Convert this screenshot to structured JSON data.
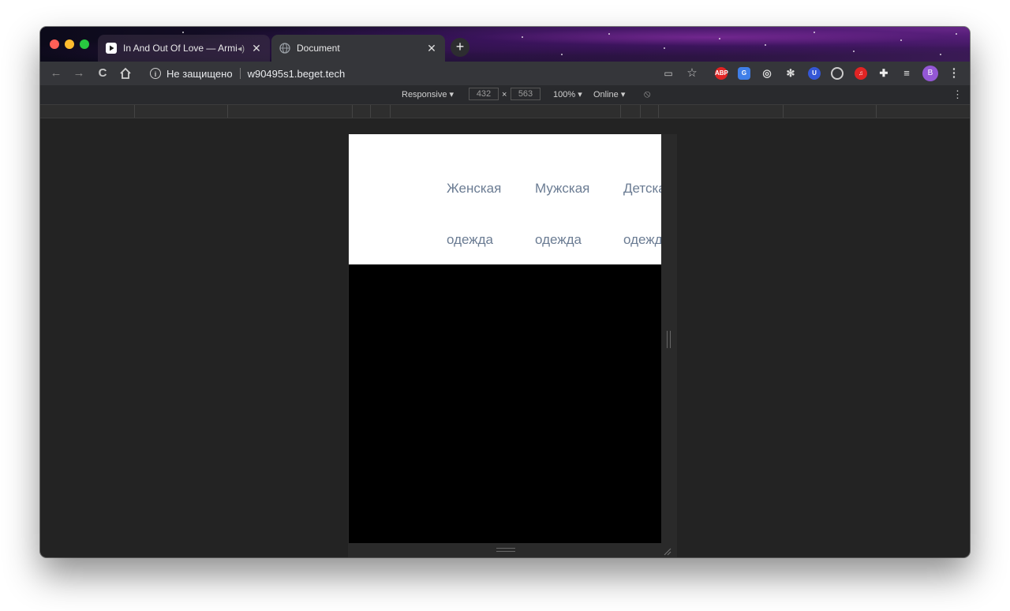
{
  "browser": {
    "tabs": [
      {
        "title": "In And Out Of Love — Armi",
        "icon": "play-icon",
        "audio_icon": "speaker-icon",
        "active": false
      },
      {
        "title": "Document",
        "icon": "globe-icon",
        "active": true
      }
    ],
    "new_tab_label": "+",
    "toolbar": {
      "security_label": "Не защищено",
      "url": "w90495s1.beget.tech",
      "profile_initial": "B",
      "extensions": [
        "abp-icon",
        "translate-icon",
        "fingerprint-icon",
        "react-icon",
        "ublock-icon",
        "record-icon",
        "music-icon",
        "puzzle-icon",
        "queue-icon"
      ]
    }
  },
  "devtools": {
    "device": "Responsive",
    "width": "432",
    "height": "563",
    "times": "×",
    "zoom": "100%",
    "throttle": "Online"
  },
  "page": {
    "background": "#000000",
    "nav": {
      "items": [
        {
          "label": "Женская одежда"
        },
        {
          "label": "Мужская одежда"
        },
        {
          "label": "Детская одежда"
        }
      ],
      "text_color": "#6b7c93"
    }
  }
}
